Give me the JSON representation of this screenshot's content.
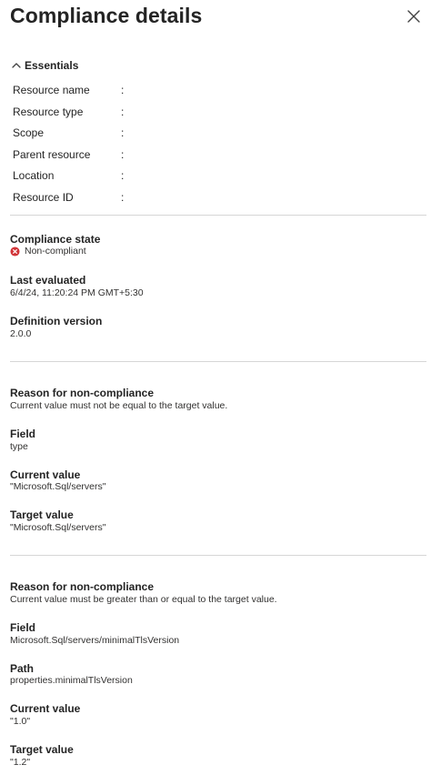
{
  "header": {
    "title": "Compliance details"
  },
  "essentials": {
    "toggle_label": "Essentials",
    "separator": ":",
    "rows": [
      {
        "label": "Resource name"
      },
      {
        "label": "Resource type"
      },
      {
        "label": "Scope"
      },
      {
        "label": "Parent resource"
      },
      {
        "label": "Location"
      },
      {
        "label": "Resource ID"
      }
    ]
  },
  "summary": {
    "compliance_state": {
      "label": "Compliance state",
      "value": "Non-compliant",
      "icon": "error-circle-icon",
      "icon_color": "#d13438"
    },
    "last_evaluated": {
      "label": "Last evaluated",
      "value": "6/4/24, 11:20:24 PM GMT+5:30"
    },
    "definition_version": {
      "label": "Definition version",
      "value": "2.0.0"
    }
  },
  "reasons": [
    {
      "reason_label": "Reason for non-compliance",
      "reason_text": "Current value must not be equal to the target value.",
      "field_label": "Field",
      "field_value": "type",
      "current_label": "Current value",
      "current_value": "\"Microsoft.Sql/servers\"",
      "target_label": "Target value",
      "target_value": "\"Microsoft.Sql/servers\""
    },
    {
      "reason_label": "Reason for non-compliance",
      "reason_text": "Current value must be greater than or equal to the target value.",
      "field_label": "Field",
      "field_value": "Microsoft.Sql/servers/minimalTlsVersion",
      "path_label": "Path",
      "path_value": "properties.minimalTlsVersion",
      "current_label": "Current value",
      "current_value": "\"1.0\"",
      "target_label": "Target value",
      "target_value": "\"1.2\""
    }
  ]
}
